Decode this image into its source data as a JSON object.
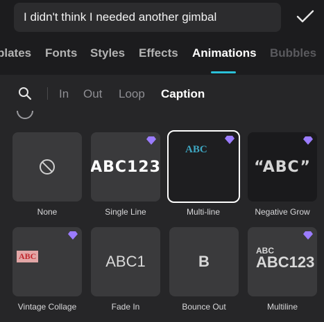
{
  "text_input": {
    "value": "I didn't think I needed another gimbal"
  },
  "confirm_icon": "checkmark-icon",
  "tabs": [
    {
      "label": "plates",
      "state": "normal"
    },
    {
      "label": "Fonts",
      "state": "normal"
    },
    {
      "label": "Styles",
      "state": "normal"
    },
    {
      "label": "Effects",
      "state": "normal"
    },
    {
      "label": "Animations",
      "state": "active"
    },
    {
      "label": "Bubbles",
      "state": "dim"
    }
  ],
  "subtabs": [
    {
      "label": "In"
    },
    {
      "label": "Out"
    },
    {
      "label": "Loop"
    },
    {
      "label": "Caption",
      "state": "active"
    }
  ],
  "colors": {
    "accent": "#2bc1d9",
    "premium": "#9b7cff"
  },
  "animations": [
    {
      "label": "None",
      "preview": "",
      "premium": false
    },
    {
      "label": "Single Line",
      "preview": "ABC123",
      "premium": true
    },
    {
      "label": "Multi-line",
      "preview": "ABC",
      "premium": true,
      "selected": true
    },
    {
      "label": "Negative Grow",
      "preview": "“ABC”",
      "premium": true
    },
    {
      "label": "Vintage Collage",
      "preview": "ABC",
      "premium": true
    },
    {
      "label": "Fade In",
      "preview": "ABC1",
      "premium": false
    },
    {
      "label": "Bounce Out",
      "preview": "B",
      "premium": false
    },
    {
      "label": "Multiline",
      "preview_top": "ABC",
      "preview": "ABC123",
      "premium": true
    }
  ]
}
